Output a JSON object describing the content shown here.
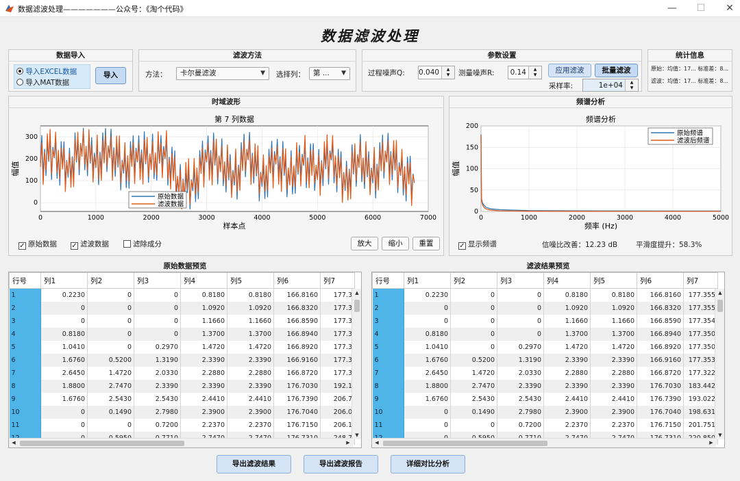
{
  "window": {
    "title": "数据滤波处理———————公众号：《淘个代码》",
    "minimize_glyph": "—",
    "maximize_glyph": "☐",
    "close_glyph": "✕"
  },
  "main_title": "数据滤波处理",
  "import_panel": {
    "title": "数据导入",
    "options": [
      "导入EXCEL数据",
      "导入MAT数据"
    ],
    "selected_index": 0,
    "button": "导入"
  },
  "filter_panel": {
    "title": "滤波方法",
    "method_label": "方法：",
    "method_value": "卡尔曼滤波",
    "column_label": "选择列：",
    "column_value": "第 ..."
  },
  "params_panel": {
    "title": "参数设置",
    "q_label": "过程噪声Q:",
    "q_value": "0.040",
    "r_label": "测量噪声R:",
    "r_value": "0.14",
    "fs_label": "采样率:",
    "fs_value": "1e+04",
    "apply_button": "应用滤波",
    "batch_button": "批量滤波"
  },
  "stats_panel": {
    "title": "统计信息",
    "original_line": "原始：均值：17... 标准差：8...",
    "filtered_line": "滤波：均值：17... 标准差：8..."
  },
  "time_panel": {
    "title": "时域波形",
    "checkboxes": [
      {
        "label": "原始数据",
        "checked": true
      },
      {
        "label": "滤波数据",
        "checked": true
      },
      {
        "label": "滤除成分",
        "checked": false
      }
    ],
    "zoom_in": "放大",
    "zoom_out": "缩小",
    "reset": "重置"
  },
  "freq_panel": {
    "title": "频谱分析",
    "show_spectrum": "显示频谱",
    "show_checked": true,
    "snr_text": "信噪比改善：12.23 dB",
    "smooth_text": "平滑度提升：58.3%"
  },
  "chart_data": [
    {
      "type": "line",
      "title": "第 7 列数据",
      "xlabel": "样本点",
      "ylabel": "幅值",
      "xlim": [
        0,
        7000
      ],
      "ylim": [
        -40,
        350
      ],
      "xticks": [
        0,
        1000,
        2000,
        3000,
        4000,
        5000,
        6000,
        7000
      ],
      "yticks": [
        0,
        100,
        200,
        300
      ],
      "grid": true,
      "legend_position": "bottom-center",
      "series": [
        {
          "name": "原始数据",
          "color": "#2e75b6",
          "x": [
            0,
            250,
            500,
            750,
            1000,
            1250,
            1500,
            1750,
            2000,
            2250,
            2500,
            2750,
            3000,
            3250,
            3500,
            3750,
            4000,
            4250,
            4500,
            4750,
            5000,
            5250,
            5500,
            5750,
            6000,
            6250,
            6500,
            6750
          ],
          "y": [
            200,
            230,
            150,
            250,
            190,
            240,
            160,
            220,
            190,
            230,
            70,
            80,
            220,
            180,
            110,
            230,
            100,
            210,
            110,
            200,
            130,
            220,
            90,
            200,
            120,
            220,
            150,
            90
          ]
        },
        {
          "name": "滤波数据",
          "color": "#e05a1a",
          "x": [
            0,
            250,
            500,
            750,
            1000,
            1250,
            1500,
            1750,
            2000,
            2250,
            2500,
            2750,
            3000,
            3250,
            3500,
            3750,
            4000,
            4250,
            4500,
            4750,
            5000,
            5250,
            5500,
            5750,
            6000,
            6250,
            6500,
            6750
          ],
          "y": [
            195,
            225,
            155,
            245,
            185,
            235,
            165,
            215,
            185,
            225,
            75,
            85,
            215,
            175,
            115,
            225,
            105,
            205,
            115,
            195,
            135,
            215,
            95,
            195,
            125,
            215,
            145,
            95
          ]
        }
      ]
    },
    {
      "type": "line",
      "title": "频谱分析",
      "xlabel": "频率 (Hz)",
      "ylabel": "幅值",
      "xlim": [
        0,
        5000
      ],
      "ylim": [
        0,
        200
      ],
      "xticks": [
        0,
        1000,
        2000,
        3000,
        4000,
        5000
      ],
      "yticks": [
        0,
        50,
        100,
        150,
        200
      ],
      "grid": true,
      "legend_position": "top-right",
      "series": [
        {
          "name": "原始频谱",
          "color": "#2e75b6",
          "x": [
            0,
            10,
            30,
            60,
            100,
            200,
            400,
            700,
            1000,
            2000,
            3000,
            4000,
            5000
          ],
          "y": [
            180,
            30,
            20,
            15,
            10,
            6,
            4,
            3,
            2,
            1.5,
            1.2,
            1,
            1
          ]
        },
        {
          "name": "滤波后频谱",
          "color": "#e05a1a",
          "x": [
            0,
            10,
            30,
            60,
            100,
            200,
            400,
            700,
            1000,
            2000,
            3000,
            4000,
            5000
          ],
          "y": [
            178,
            25,
            16,
            10,
            6,
            3,
            1.5,
            1,
            0.5,
            0.3,
            0.2,
            0.2,
            0.2
          ]
        }
      ]
    }
  ],
  "original_table": {
    "title": "原始数据预览",
    "columns": [
      "行号",
      "列1",
      "列2",
      "列3",
      "列4",
      "列5",
      "列6",
      "列7"
    ],
    "rows": [
      [
        "1",
        "0.2230",
        "0",
        "0",
        "0.8180",
        "0.8180",
        "166.8160",
        "177.3"
      ],
      [
        "2",
        "0",
        "0",
        "0",
        "1.0920",
        "1.0920",
        "166.8320",
        "177.3"
      ],
      [
        "3",
        "0",
        "0",
        "0",
        "1.1660",
        "1.1660",
        "166.8590",
        "177.3"
      ],
      [
        "4",
        "0.8180",
        "0",
        "0",
        "1.3700",
        "1.3700",
        "166.8940",
        "177.3"
      ],
      [
        "5",
        "1.0410",
        "0",
        "0.2970",
        "1.4720",
        "1.4720",
        "166.8920",
        "177.3"
      ],
      [
        "6",
        "1.6760",
        "0.5200",
        "1.3190",
        "2.3390",
        "2.3390",
        "166.9160",
        "177.3"
      ],
      [
        "7",
        "2.6450",
        "1.4720",
        "2.0330",
        "2.2880",
        "2.2880",
        "166.8720",
        "177.3"
      ],
      [
        "8",
        "1.8800",
        "2.7470",
        "2.3390",
        "2.3390",
        "2.3390",
        "176.7030",
        "192.1"
      ],
      [
        "9",
        "1.6760",
        "2.5430",
        "2.5430",
        "2.4410",
        "2.4410",
        "176.7390",
        "206.7"
      ],
      [
        "10",
        "0",
        "0.1490",
        "2.7980",
        "2.3900",
        "2.3900",
        "176.7040",
        "206.0"
      ],
      [
        "11",
        "0",
        "0",
        "0.7200",
        "2.2370",
        "2.2370",
        "176.7150",
        "206.1"
      ],
      [
        "12",
        "0",
        "0.5950",
        "0.7710",
        "2.7470",
        "2.7470",
        "176.7310",
        "248.7"
      ]
    ]
  },
  "filtered_table": {
    "title": "滤波结果预览",
    "columns": [
      "行号",
      "列1",
      "列2",
      "列3",
      "列4",
      "列5",
      "列6",
      "列7"
    ],
    "rows": [
      [
        "1",
        "0.2230",
        "0",
        "0",
        "0.8180",
        "0.8180",
        "166.8160",
        "177.355"
      ],
      [
        "2",
        "0",
        "0",
        "0",
        "1.0920",
        "1.0920",
        "166.8320",
        "177.355"
      ],
      [
        "3",
        "0",
        "0",
        "0",
        "1.1660",
        "1.1660",
        "166.8590",
        "177.354"
      ],
      [
        "4",
        "0.8180",
        "0",
        "0",
        "1.3700",
        "1.3700",
        "166.8940",
        "177.350"
      ],
      [
        "5",
        "1.0410",
        "0",
        "0.2970",
        "1.4720",
        "1.4720",
        "166.8920",
        "177.350"
      ],
      [
        "6",
        "1.6760",
        "0.5200",
        "1.3190",
        "2.3390",
        "2.3390",
        "166.9160",
        "177.353"
      ],
      [
        "7",
        "2.6450",
        "1.4720",
        "2.0330",
        "2.2880",
        "2.2880",
        "166.8720",
        "177.322"
      ],
      [
        "8",
        "1.8800",
        "2.7470",
        "2.3390",
        "2.3390",
        "2.3390",
        "176.7030",
        "183.442"
      ],
      [
        "9",
        "1.6760",
        "2.5430",
        "2.5430",
        "2.4410",
        "2.4410",
        "176.7390",
        "193.022"
      ],
      [
        "10",
        "0",
        "0.1490",
        "2.7980",
        "2.3900",
        "2.3900",
        "176.7040",
        "198.631"
      ],
      [
        "11",
        "0",
        "0",
        "0.7200",
        "2.2370",
        "2.2370",
        "176.7150",
        "201.751"
      ],
      [
        "12",
        "0",
        "0.5950",
        "0.7710",
        "2.7470",
        "2.7470",
        "176.7310",
        "220.850"
      ]
    ]
  },
  "bottom_buttons": [
    "导出滤波结果",
    "导出滤波报告",
    "详细对比分析"
  ]
}
